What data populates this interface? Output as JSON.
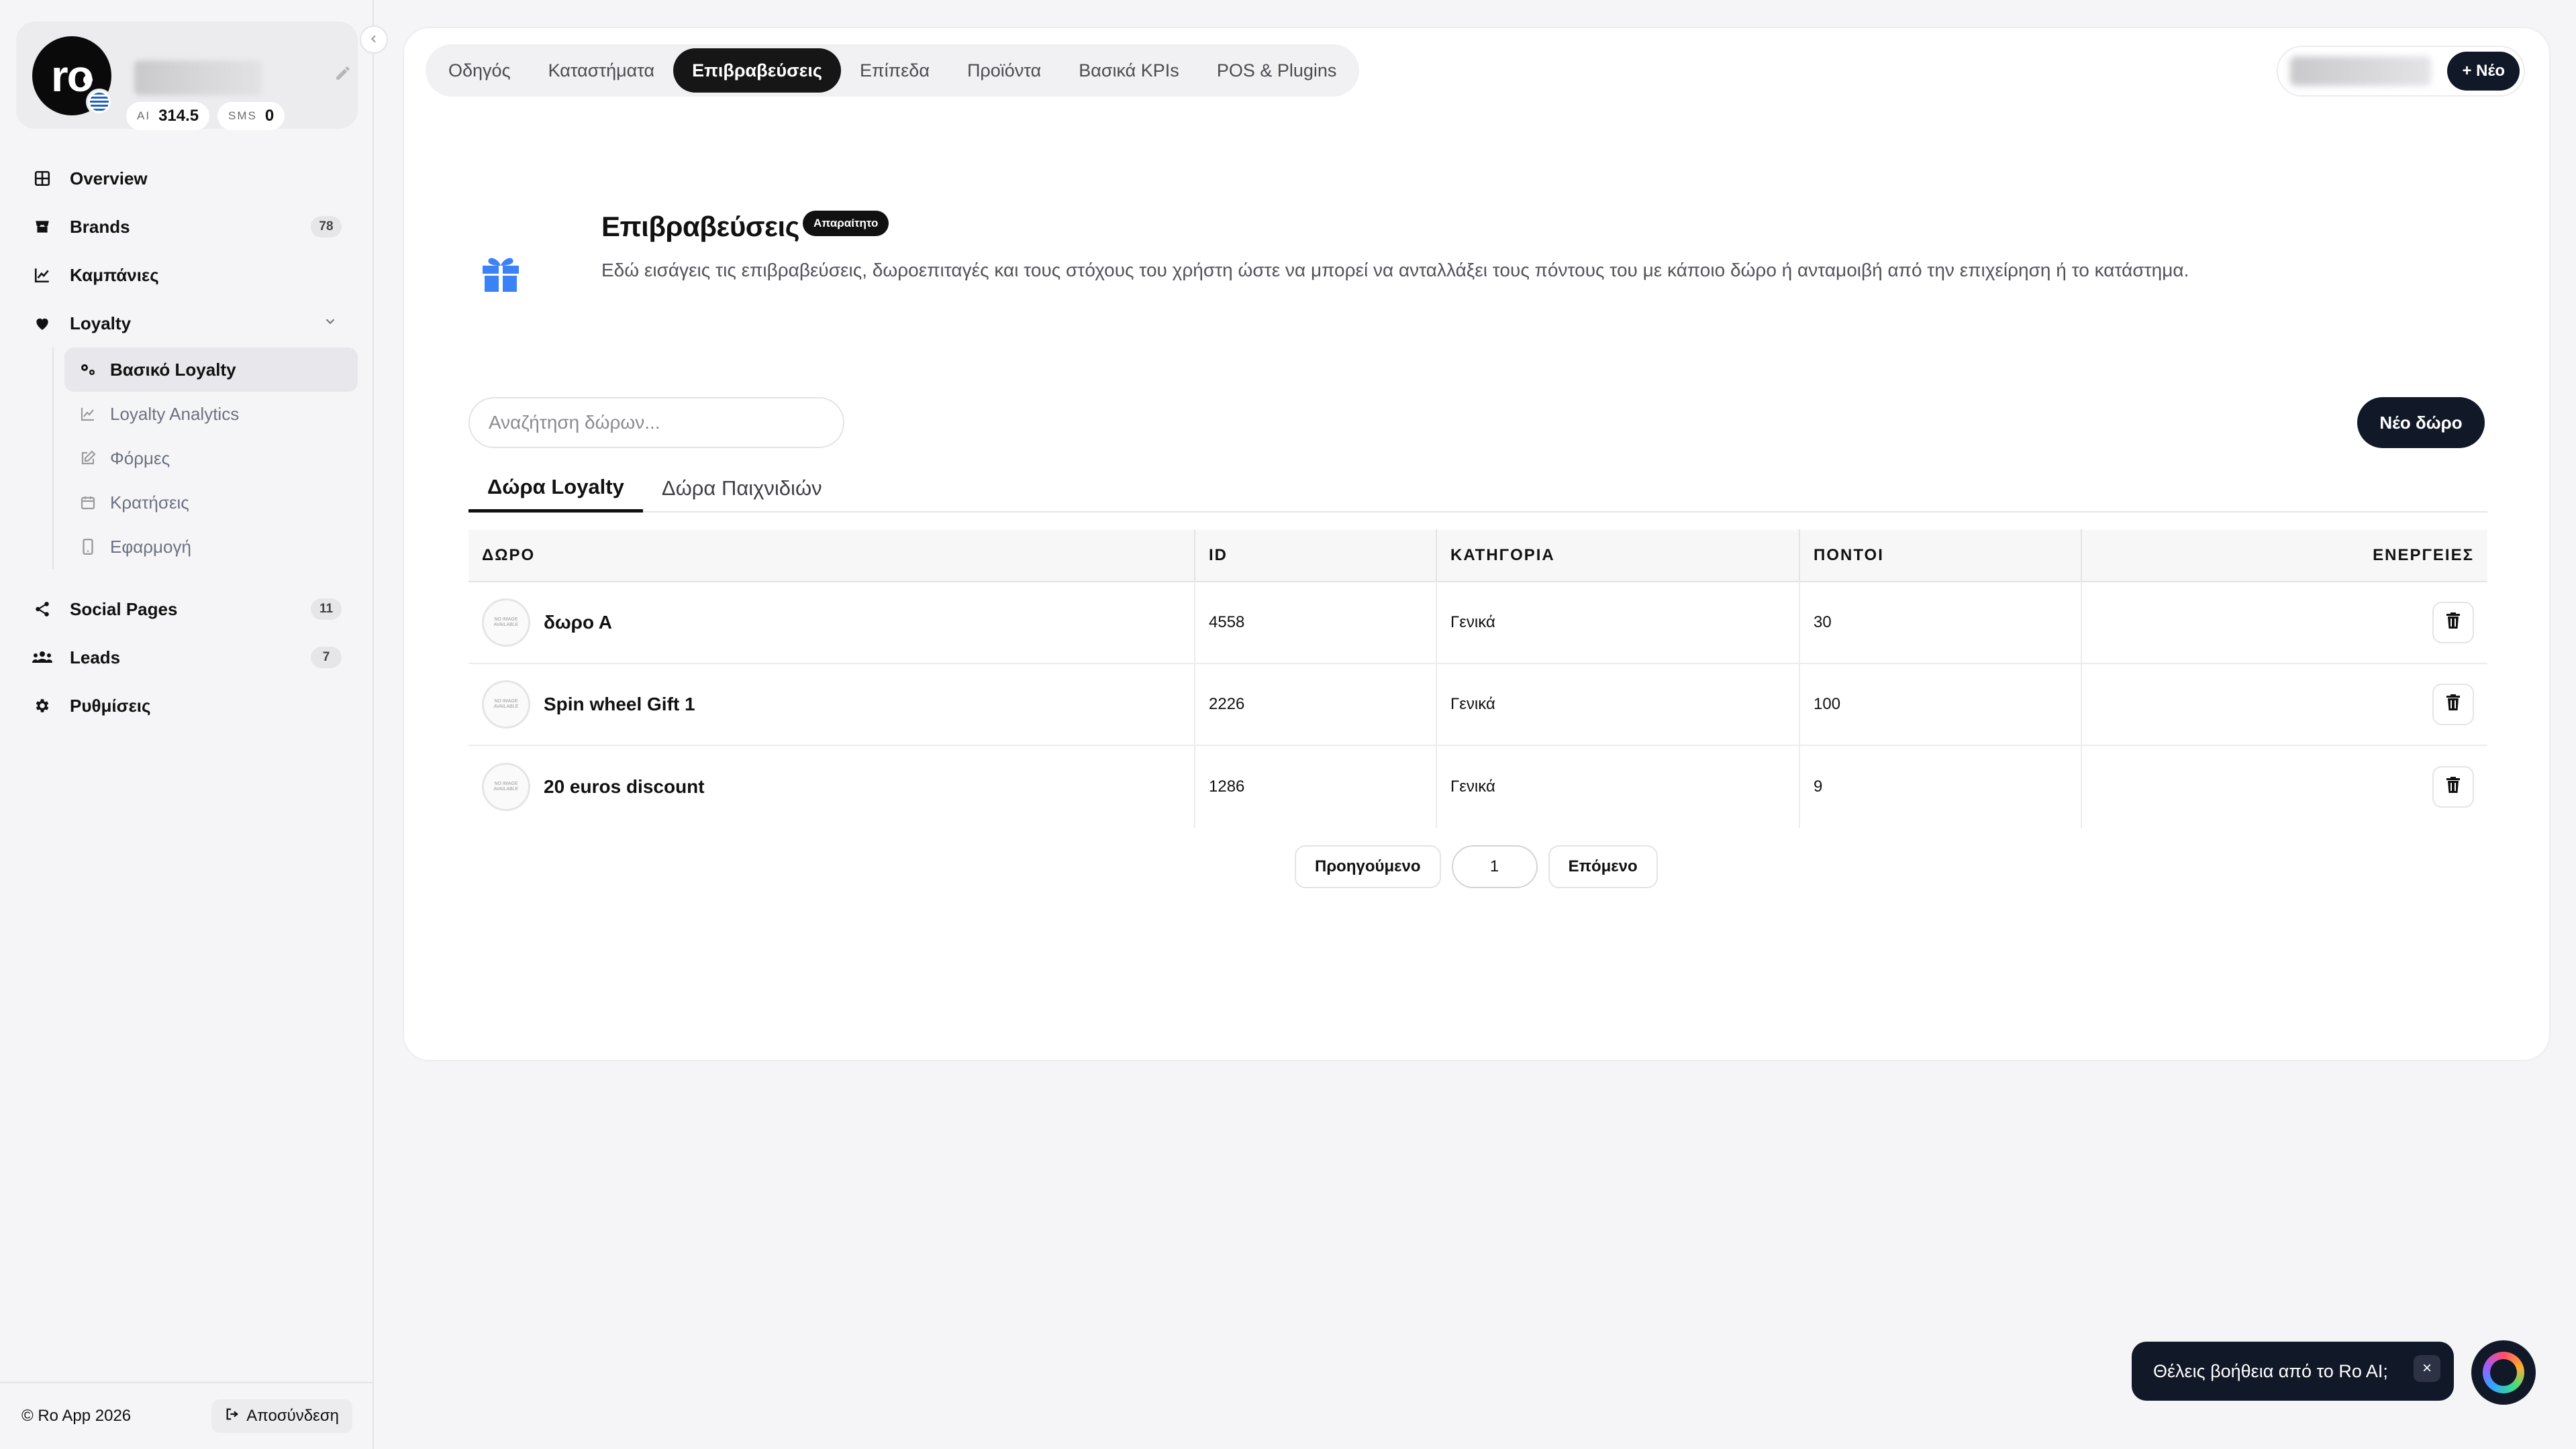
{
  "profile": {
    "avatar_text": "ro",
    "ai_label": "AI",
    "ai_value": "314.5",
    "sms_label": "SMS",
    "sms_value": "0"
  },
  "sidebar": {
    "items": [
      {
        "label": "Overview",
        "icon": "grid-icon"
      },
      {
        "label": "Brands",
        "icon": "store-icon",
        "badge": "78"
      },
      {
        "label": "Καμπάνιες",
        "icon": "chart-line-icon"
      },
      {
        "label": "Loyalty",
        "icon": "heart-icon"
      },
      {
        "label": "Social Pages",
        "icon": "share-icon",
        "badge": "11"
      },
      {
        "label": "Leads",
        "icon": "users-icon",
        "badge": "7"
      },
      {
        "label": "Ρυθμίσεις",
        "icon": "gear-icon"
      }
    ],
    "loyalty_sub": [
      {
        "label": "Βασικό Loyalty",
        "icon": "cogs-icon"
      },
      {
        "label": "Loyalty Analytics",
        "icon": "analytics-icon"
      },
      {
        "label": "Φόρμες",
        "icon": "edit-icon"
      },
      {
        "label": "Κρατήσεις",
        "icon": "calendar-icon"
      },
      {
        "label": "Εφαρμογή",
        "icon": "phone-icon"
      }
    ],
    "footer": {
      "copyright": "© Ro App  2026",
      "logout": "Αποσύνδεση"
    }
  },
  "top_tabs": [
    "Οδηγός",
    "Καταστήματα",
    "Επιβραβεύσεις",
    "Επίπεδα",
    "Προϊόντα",
    "Βασικά KPIs",
    "POS & Plugins"
  ],
  "top_right": {
    "new_button": "+ Νέο"
  },
  "section": {
    "title": "Επιβραβεύσεις",
    "required_badge": "Απαραίτητο",
    "description": "Εδώ εισάγεις τις επιβραβεύσεις, δωροεπιταγές και τους στόχους του χρήστη ώστε να μπορεί να ανταλλάξει τους πόντους του με κάποιο δώρο ή ανταμοιβή από την επιχείρηση ή το κατάστημα."
  },
  "search": {
    "placeholder": "Αναζήτηση δώρων..."
  },
  "new_gift_button": "Νέο δώρο",
  "sub_tabs": [
    "Δώρα Loyalty",
    "Δώρα Παιχνιδιών"
  ],
  "table": {
    "headers": [
      "ΔΩΡΟ",
      "ID",
      "ΚΑΤΗΓΟΡΙΑ",
      "ΠΟΝΤΟΙ",
      "ΕΝΕΡΓΕΙΕΣ"
    ],
    "thumb_text": "NO IMAGE AVAILABLE",
    "rows": [
      {
        "name": "δωρο Α",
        "id": "4558",
        "category": "Γενικά",
        "points": "30"
      },
      {
        "name": "Spin wheel Gift 1",
        "id": "2226",
        "category": "Γενικά",
        "points": "100"
      },
      {
        "name": "20 euros discount",
        "id": "1286",
        "category": "Γενικά",
        "points": "9"
      }
    ]
  },
  "pagination": {
    "prev": "Προηγούμενο",
    "page": "1",
    "next": "Επόμενο"
  },
  "help": {
    "text": "Θέλεις βοήθεια από το Ro AI;",
    "close": "×"
  },
  "colors": {
    "accent": "#111827",
    "gift_icon": "#3b82f6"
  }
}
